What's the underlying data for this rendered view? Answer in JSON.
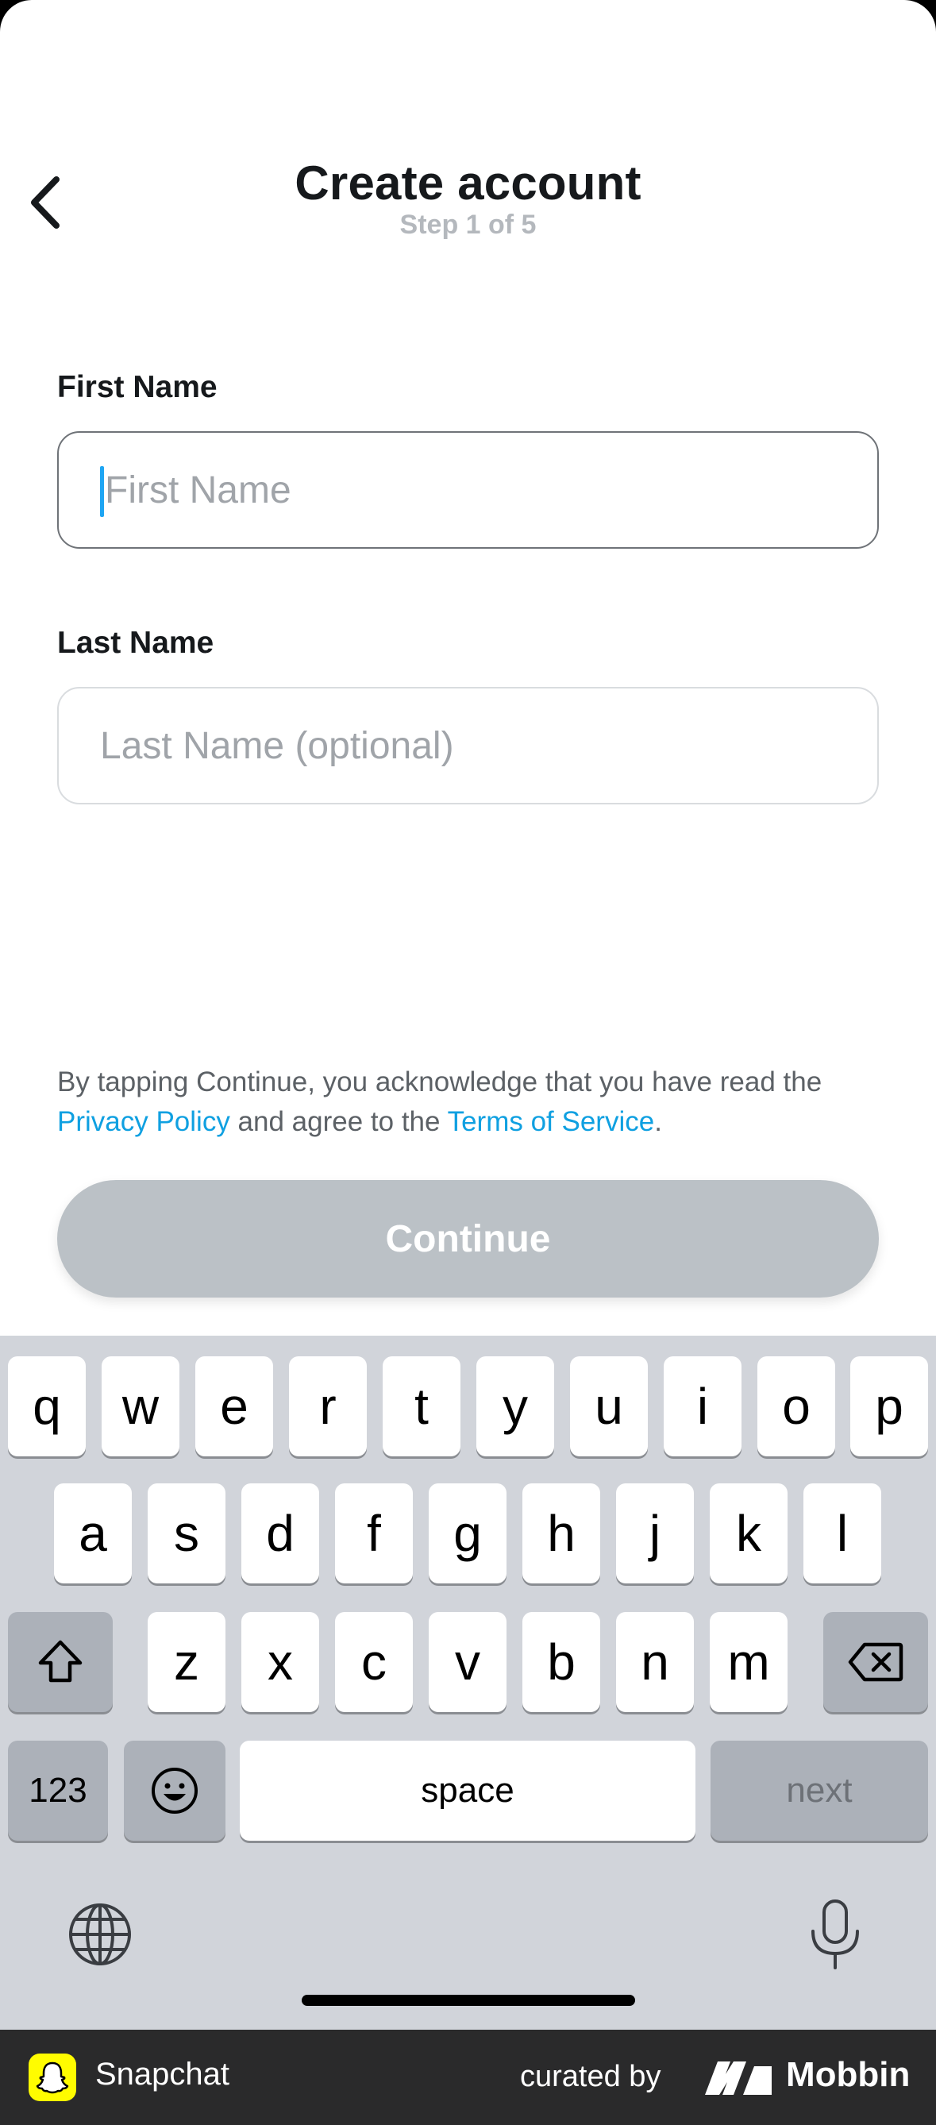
{
  "header": {
    "title": "Create account",
    "step": "Step 1 of 5"
  },
  "form": {
    "first_name": {
      "label": "First Name",
      "placeholder": "First Name",
      "value": ""
    },
    "last_name": {
      "label": "Last Name",
      "placeholder": "Last Name (optional)",
      "value": ""
    }
  },
  "legal": {
    "prefix": "By tapping Continue, you acknowledge that you have read the ",
    "privacy": "Privacy Policy",
    "middle": " and agree to the ",
    "terms": "Terms of Service",
    "suffix": "."
  },
  "continue_label": "Continue",
  "keyboard": {
    "row1": [
      "q",
      "w",
      "e",
      "r",
      "t",
      "y",
      "u",
      "i",
      "o",
      "p"
    ],
    "row2": [
      "a",
      "s",
      "d",
      "f",
      "g",
      "h",
      "j",
      "k",
      "l"
    ],
    "row3": [
      "z",
      "x",
      "c",
      "v",
      "b",
      "n",
      "m"
    ],
    "numbers_label": "123",
    "space_label": "space",
    "next_label": "next"
  },
  "banner": {
    "app_name": "Snapchat",
    "curated_by": "curated by",
    "brand": "Mobbin"
  },
  "colors": {
    "accent_link": "#0fa0e1",
    "caret": "#1ea5f3",
    "button_disabled": "#bbc1c6",
    "snap_yellow": "#fffc00"
  }
}
